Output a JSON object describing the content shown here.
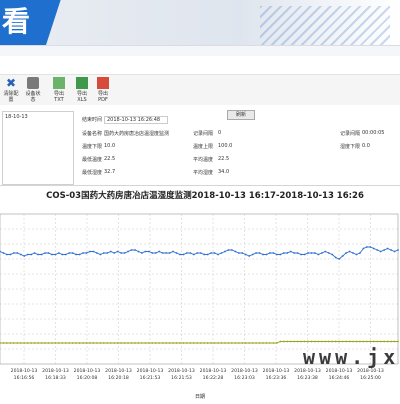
{
  "banner": {
    "title": "看"
  },
  "toolbar": {
    "items": [
      {
        "label": "清除配置",
        "icon": "close-icon"
      },
      {
        "label": "设备状态",
        "icon": "device-icon"
      },
      {
        "label": "导出TXT",
        "icon": "txt-export-icon"
      },
      {
        "label": "导出XLS",
        "icon": "xls-export-icon"
      },
      {
        "label": "导出PDF",
        "icon": "pdf-export-icon"
      }
    ]
  },
  "info": {
    "left_date": "18-10-13",
    "end_time_label": "结束时间",
    "end_time_value": "2018-10-13 16:26:48",
    "query_button": "刷新",
    "device_name_label": "设备名称",
    "device_name_value": "国药大药房唐冶店温湿度监测",
    "record_interval_label": "记录间隔",
    "record_interval_value": "0",
    "record_interval2_label": "记录间隔",
    "record_interval2_value": "00:00:05",
    "temp_lower_label": "温度下限",
    "temp_lower_value": "10.0",
    "temp_upper_label": "温度上限",
    "temp_upper_value": "100.0",
    "hum_lower_label": "湿度下限",
    "hum_lower_value": "0.0",
    "avg_temp_label": "最低温度",
    "avg_temp_value": "22.5",
    "avg_temp2_label": "平均温度",
    "avg_temp2_value": "22.5",
    "avg_hum_label": "最低湿度",
    "avg_hum_value": "32.7",
    "avg_hum2_label": "平均湿度",
    "avg_hum2_value": "34.0"
  },
  "chart_data": {
    "type": "line",
    "title": "COS-03国药大药房唐冶店温湿度监测2018-10-13  16:17-2018-10-13  16:26",
    "xlabel": "日期",
    "x_ticks": [
      {
        "date": "2018-10-13",
        "time": "16:16:56"
      },
      {
        "date": "2018-10-13",
        "time": "16:18:33"
      },
      {
        "date": "2018-10-13",
        "time": "16:20:08"
      },
      {
        "date": "2018-10-13",
        "time": "16:20:18"
      },
      {
        "date": "2018-10-13",
        "time": "16:21:53"
      },
      {
        "date": "2018-10-13",
        "time": "16:21:53"
      },
      {
        "date": "2018-10-13",
        "time": "16:22:28"
      },
      {
        "date": "2018-10-13",
        "time": "16:23:03"
      },
      {
        "date": "2018-10-13",
        "time": "16:23:36"
      },
      {
        "date": "2018-10-13",
        "time": "16:23:38"
      },
      {
        "date": "2018-10-13",
        "time": "16:24:46"
      },
      {
        "date": "2018-10-13",
        "time": "16:25:00"
      }
    ],
    "ylim": [
      0,
      100
    ],
    "grid": true,
    "series": [
      {
        "name": "",
        "color": "#2e6fd2",
        "values": [
          75,
          74,
          73,
          73,
          74,
          74,
          73,
          72,
          73,
          73,
          74,
          73,
          73,
          74,
          74,
          73,
          73,
          74,
          73,
          73,
          74,
          74,
          73,
          73,
          74,
          74,
          75,
          75,
          74,
          73,
          74,
          74,
          75,
          74,
          75,
          74,
          74,
          75,
          76,
          76,
          75,
          74,
          75,
          75,
          74,
          74,
          75,
          74,
          74,
          74,
          75,
          74,
          73,
          73,
          74,
          74,
          73,
          74,
          74,
          73,
          73,
          74,
          74,
          73,
          74,
          75,
          76,
          76,
          75,
          74,
          74,
          73,
          72,
          73,
          74,
          74,
          73,
          73,
          74,
          74,
          73,
          73,
          74,
          74,
          75,
          74,
          74,
          73,
          73,
          74,
          74,
          74,
          73,
          74,
          75,
          74,
          73,
          71,
          70,
          72,
          74,
          75,
          74,
          73,
          74,
          77,
          78,
          78,
          77,
          76,
          75,
          76,
          77,
          76,
          75,
          76
        ]
      },
      {
        "name": "",
        "color": "#9aa51c",
        "values": [
          14,
          14,
          14,
          14,
          14,
          14,
          14,
          14,
          14,
          14,
          14,
          14,
          14,
          14,
          14,
          14,
          14,
          14,
          14,
          14,
          14,
          14,
          14,
          14,
          14,
          14,
          14,
          14,
          14,
          14,
          14,
          14,
          14,
          14,
          14,
          14,
          14,
          14,
          14,
          14,
          14,
          14,
          14,
          14,
          14,
          14,
          14,
          14,
          14,
          14,
          14,
          14,
          14,
          14,
          14,
          14,
          14,
          14,
          14,
          14,
          14,
          14,
          14,
          14,
          14,
          14,
          14,
          14,
          14,
          14,
          14,
          14,
          14,
          14,
          14,
          14,
          14,
          14,
          14,
          14,
          14,
          15,
          15,
          15,
          15,
          15,
          15,
          15,
          15,
          15,
          15,
          15,
          15,
          15,
          15,
          15,
          15,
          15,
          15,
          15,
          15,
          15,
          15,
          15,
          15,
          15,
          15,
          15,
          15,
          15,
          15,
          15,
          15,
          15,
          15,
          15
        ]
      }
    ]
  },
  "watermark": "www.jx"
}
